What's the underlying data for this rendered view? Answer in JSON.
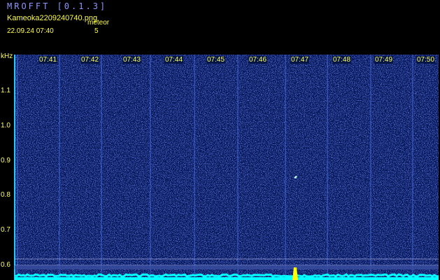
{
  "header": {
    "app_title": "MROFFT [0.1.3]",
    "file_name": "Kameoka2209240740.png",
    "meteor_label": "meteor",
    "datetime": "22.09.24 07:40",
    "meteor_count": "5"
  },
  "axis": {
    "y_unit": "kHz",
    "y_ticks": [
      "1.1",
      "1.0",
      "0.9",
      "0.8",
      "0.7",
      "0.6"
    ],
    "x_ticks": [
      "07:41",
      "07:42",
      "07:43",
      "07:44",
      "07:45",
      "07:46",
      "07:47",
      "07:48",
      "07:49",
      "07:50"
    ]
  },
  "colors": {
    "background": "#000000",
    "title": "#8f95ff",
    "label": "#ffff44",
    "noise_base": "#07185a",
    "baseline": "#00ffff",
    "meteor_trace": "#ffff00"
  }
}
